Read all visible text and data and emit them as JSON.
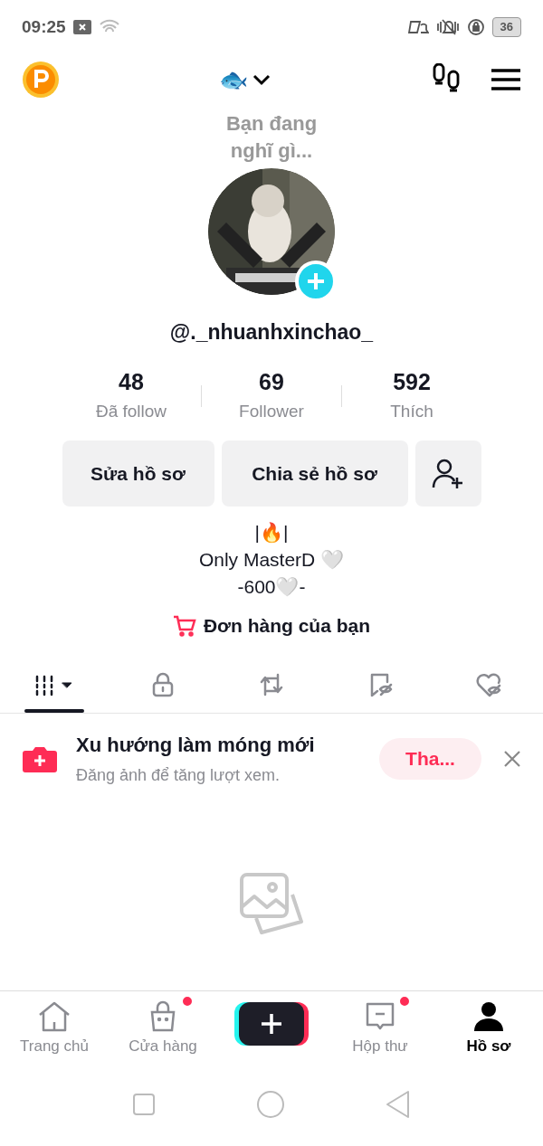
{
  "status_bar": {
    "time": "09:25",
    "battery": "36"
  },
  "header": {
    "title_emoji": "🐟"
  },
  "profile": {
    "thought": "Bạn đang nghĩ gì...",
    "username": "@._nhuanhxinchao_"
  },
  "stats": [
    {
      "value": "48",
      "label": "Đã follow"
    },
    {
      "value": "69",
      "label": "Follower"
    },
    {
      "value": "592",
      "label": "Thích"
    }
  ],
  "actions": [
    {
      "kind": "text",
      "label": "Sửa hồ sơ"
    },
    {
      "kind": "text",
      "label": "Chia sẻ hồ sơ"
    },
    {
      "kind": "add-friend"
    }
  ],
  "bio": [
    "|🔥|",
    "Only MasterD 🤍",
    "-600🤍-"
  ],
  "orders_link": "Đơn hàng của bạn",
  "tabs": [
    {
      "kind": "videos",
      "selected": true
    },
    {
      "kind": "private",
      "selected": false
    },
    {
      "kind": "reposts",
      "selected": false
    },
    {
      "kind": "saved",
      "selected": false
    },
    {
      "kind": "liked",
      "selected": false
    }
  ],
  "banner": {
    "title": "Xu hướng làm móng mới",
    "subtitle": "Đăng ảnh để tăng lượt xem.",
    "button": "Tha..."
  },
  "bottom_nav": [
    {
      "kind": "home",
      "label": "Trang chủ",
      "selected": false,
      "badge": false
    },
    {
      "kind": "shop",
      "label": "Cửa hàng",
      "selected": false,
      "badge": true
    },
    {
      "kind": "create",
      "selected": false
    },
    {
      "kind": "inbox",
      "label": "Hộp thư",
      "selected": false,
      "badge": true
    },
    {
      "kind": "profile",
      "label": "Hồ sơ",
      "selected": true,
      "badge": false
    }
  ]
}
